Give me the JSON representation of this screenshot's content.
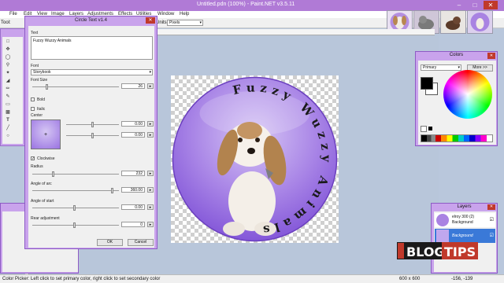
{
  "window": {
    "title": "Untitled.pdn (100%) - Paint.NET v3.5.11",
    "minimize": "–",
    "maximize": "□",
    "close": "✕"
  },
  "menu": [
    "File",
    "Edit",
    "View",
    "Image",
    "Layers",
    "Adjustments",
    "Effects",
    "Utilities",
    "Window",
    "Help"
  ],
  "toolbar": {
    "tool_label": "Tool:",
    "units_label": "Units:",
    "units_value": "Pixels"
  },
  "dialog": {
    "title": "Circle Text v1.4",
    "close": "✕",
    "text_label": "Text",
    "text_value": "Fuzzy Wuzzy Animals",
    "font_label": "Font",
    "font_value": "Storybook",
    "font_size_label": "Font Size",
    "font_size_value": "26",
    "bold_label": "Bold",
    "italic_label": "Italic",
    "center_label": "Center",
    "center_x": "0.00",
    "center_y": "0.00",
    "clockwise_label": "Clockwise",
    "radius_label": "Radius",
    "radius_value": "232",
    "angle_arc_label": "Angle of arc",
    "angle_arc_value": "360.00",
    "angle_start_label": "Angle of start",
    "angle_start_value": "0.00",
    "rear_adj_label": "Rear adjustment",
    "rear_adj_value": "0",
    "spin_symbol": "▸",
    "ok": "OK",
    "cancel": "Cancel"
  },
  "canvas_text": {
    "circle_text": "Fuzzy Wuzzy Animals"
  },
  "colors": {
    "title": "Colors",
    "mode": "Primary",
    "more": "More >>",
    "primary_color": "#000000",
    "secondary_color": "#ffffff"
  },
  "layers": {
    "title": "Layers",
    "items": [
      {
        "name": "elroy 300 (2)",
        "sub": "Background"
      },
      {
        "name": "Background",
        "sub": ""
      }
    ]
  },
  "status": {
    "message": "Color Picker: Left click to set primary color, right click to set secondary color",
    "size": "600 x 600",
    "coords": "-156, -139"
  },
  "brand": {
    "logo_text": "BLOG TIPS"
  },
  "theme": {
    "accent": "#b07ad6",
    "window_frame": "#c9a3ec",
    "circle_purple": "#9b6fe0"
  }
}
